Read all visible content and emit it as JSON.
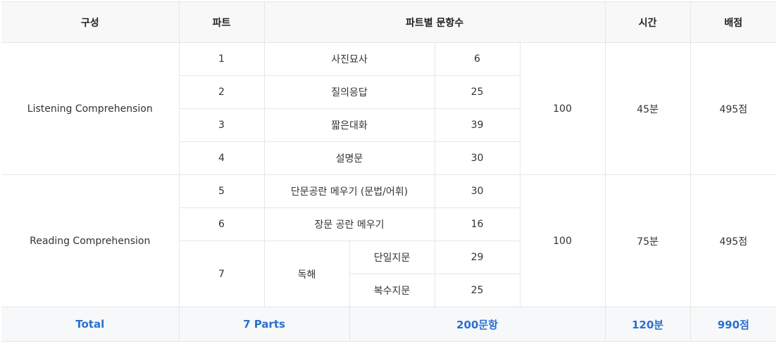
{
  "header": {
    "col_composition": "구성",
    "col_part": "파트",
    "col_items_per_part": "파트별 문항수",
    "col_time": "시간",
    "col_score": "배점"
  },
  "listening": {
    "section": "Listening Comprehension",
    "total_items": "100",
    "time": "45분",
    "score": "495점",
    "rows": [
      {
        "part": "1",
        "name": "사진묘사",
        "count": "6"
      },
      {
        "part": "2",
        "name": "질의응답",
        "count": "25"
      },
      {
        "part": "3",
        "name": "짧은대화",
        "count": "39"
      },
      {
        "part": "4",
        "name": "설명문",
        "count": "30"
      }
    ]
  },
  "reading": {
    "section": "Reading Comprehension",
    "total_items": "100",
    "time": "75분",
    "score": "495점",
    "rows": [
      {
        "part": "5",
        "name": "단문공란 메우기 (문법/어휘)",
        "count": "30"
      },
      {
        "part": "6",
        "name": "장문 공란 메우기",
        "count": "16"
      }
    ],
    "part7": {
      "part": "7",
      "name": "독해",
      "sub": [
        {
          "name": "단일지문",
          "count": "29"
        },
        {
          "name": "복수지문",
          "count": "25"
        }
      ]
    }
  },
  "total": {
    "label": "Total",
    "parts": "7 Parts",
    "items": "200문항",
    "time": "120분",
    "score": "990점"
  }
}
